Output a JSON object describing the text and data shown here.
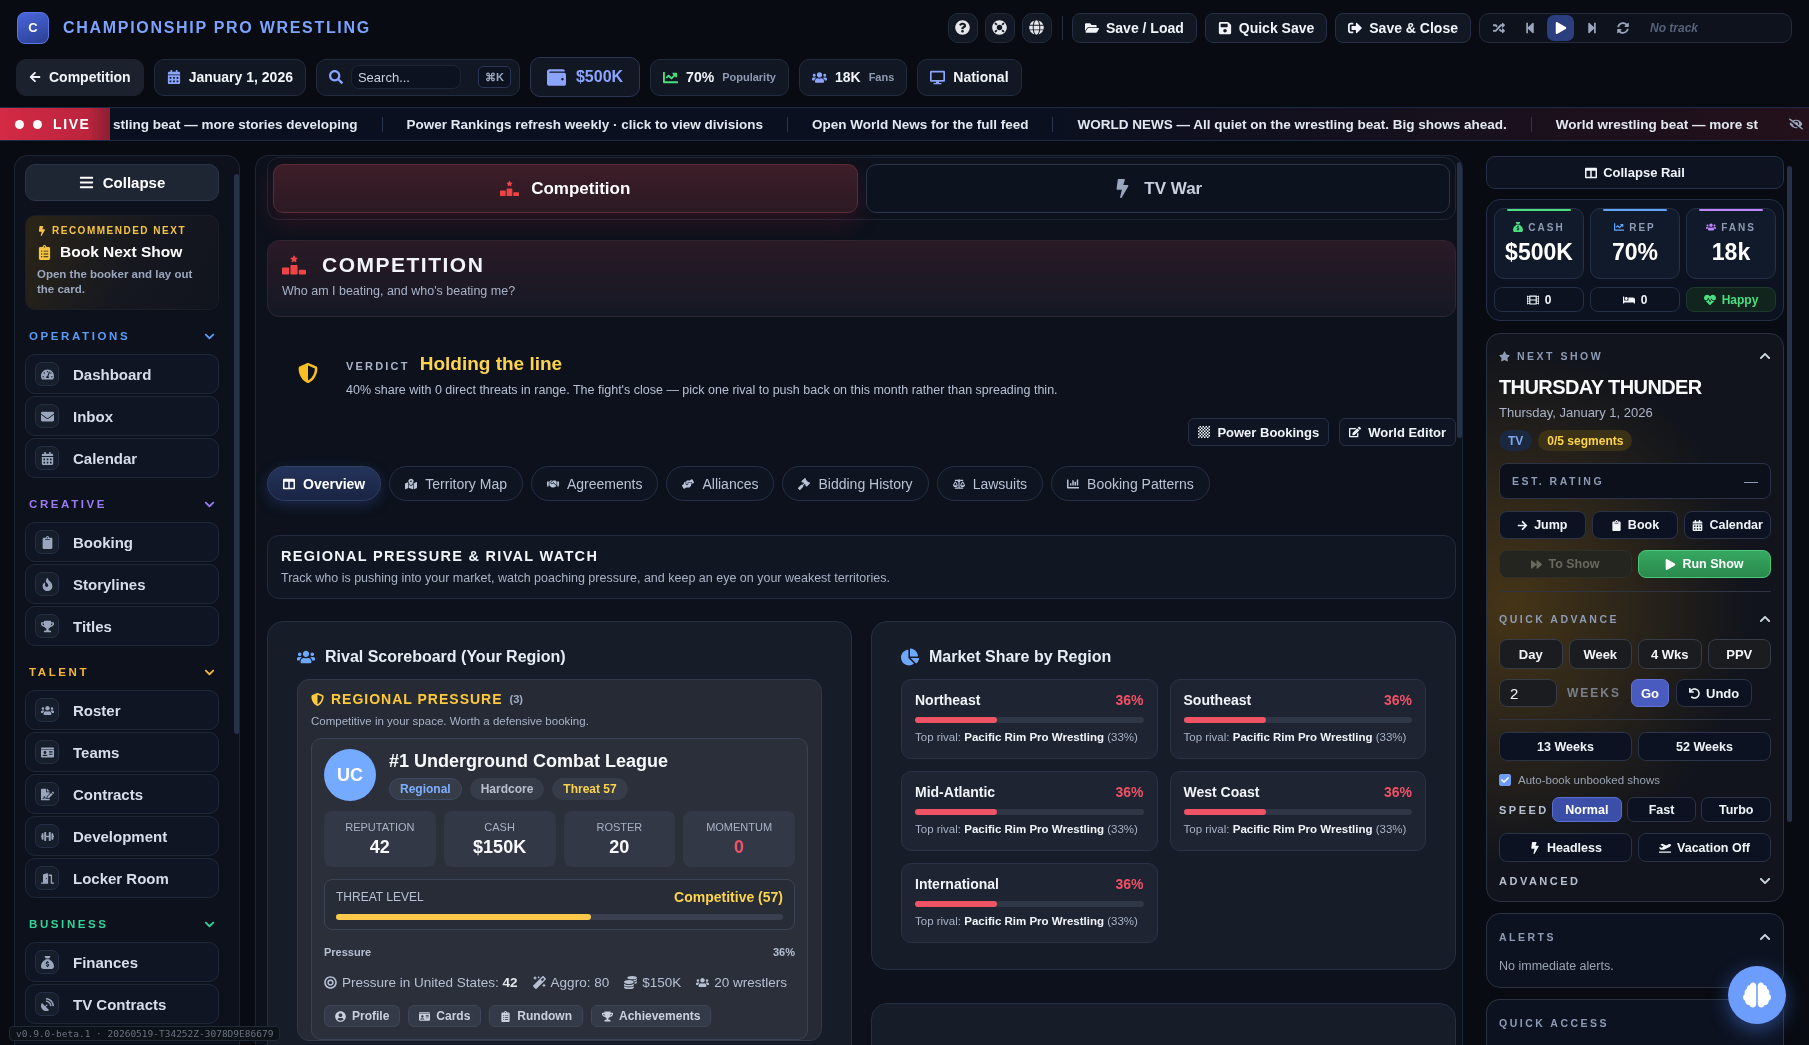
{
  "header": {
    "logo": "C",
    "title": "CHAMPIONSHIP PRO WRESTLING",
    "actions": [
      "Save / Load",
      "Quick Save",
      "Save & Close"
    ],
    "track": "No track"
  },
  "toolbar": {
    "back": "Competition",
    "date": "January 1, 2026",
    "search": {
      "placeholder": "Search...",
      "shortcut": "⌘K"
    },
    "stats": [
      {
        "kind": "money",
        "value": "$500K"
      },
      {
        "kind": "metric",
        "value": "70%",
        "label": "Popularity"
      },
      {
        "kind": "metric",
        "value": "18K",
        "label": "Fans"
      },
      {
        "kind": "plain",
        "value": "National"
      }
    ]
  },
  "ticker": {
    "badge": "LIVE",
    "items": [
      "stling beat — more stories developing",
      "Power Rankings refresh weekly · click to view divisions",
      "Open World News for the full feed",
      "WORLD NEWS — All quiet on the wrestling beat. Big shows ahead.",
      "World wrestling beat — more st"
    ]
  },
  "sidebar": {
    "collapse": "Collapse",
    "recommended": {
      "eyebrow": "RECOMMENDED NEXT",
      "title": "Book Next Show",
      "text": "Open the booker and lay out the card."
    },
    "sections": [
      {
        "title": "OPERATIONS",
        "color": "#5b9cf5",
        "expanded": true,
        "items": [
          "Dashboard",
          "Inbox",
          "Calendar"
        ]
      },
      {
        "title": "CREATIVE",
        "color": "#9b7cf6",
        "expanded": true,
        "items": [
          "Booking",
          "Storylines",
          "Titles"
        ]
      },
      {
        "title": "TALENT",
        "color": "#f5b833",
        "expanded": true,
        "items": [
          "Roster",
          "Teams",
          "Contracts",
          "Development",
          "Locker Room"
        ]
      },
      {
        "title": "BUSINESS",
        "color": "#34d399",
        "expanded": true,
        "items": [
          "Finances",
          "TV Contracts"
        ]
      }
    ]
  },
  "version": "v0.9.0-beta.1 · 20260519-T34252Z-3078D9E86679",
  "page_tabs": [
    {
      "label": "Competition",
      "selected": true
    },
    {
      "label": "TV War",
      "selected": false
    }
  ],
  "page_header": {
    "title": "COMPETITION",
    "subtitle": "Who am I beating, and who's beating me?"
  },
  "verdict": {
    "label": "VERDICT",
    "title": "Holding the line",
    "text": "40% share with 0 direct threats in range. The fight's close — pick one rival to push back on this month rather than spreading thin."
  },
  "tools": [
    "Power Bookings",
    "World Editor"
  ],
  "sub_tabs": [
    {
      "label": "Overview",
      "selected": true
    },
    {
      "label": "Territory Map",
      "selected": false
    },
    {
      "label": "Agreements",
      "selected": false
    },
    {
      "label": "Alliances",
      "selected": false
    },
    {
      "label": "Bidding History",
      "selected": false
    },
    {
      "label": "Lawsuits",
      "selected": false
    },
    {
      "label": "Booking Patterns",
      "selected": false
    }
  ],
  "overview": {
    "title": "REGIONAL PRESSURE & RIVAL WATCH",
    "text": "Track who is pushing into your market, watch poaching pressure, and keep an eye on your weakest territories."
  },
  "rival_scoreboard": {
    "title": "Rival Scoreboard (Your Region)",
    "pressure": {
      "title": "REGIONAL PRESSURE",
      "count": "(3)",
      "text": "Competitive in your space. Worth a defensive booking."
    },
    "rival": {
      "initials": "UC",
      "name": "#1 Underground Combat League",
      "tags": [
        {
          "kind": "region",
          "label": "Regional"
        },
        {
          "kind": "style",
          "label": "Hardcore"
        },
        {
          "kind": "threat",
          "label": "Threat 57"
        }
      ],
      "stats": [
        {
          "kind": "normal",
          "label": "REPUTATION",
          "value": "42"
        },
        {
          "kind": "normal",
          "label": "CASH",
          "value": "$150K"
        },
        {
          "kind": "normal",
          "label": "ROSTER",
          "value": "20"
        },
        {
          "kind": "negative",
          "label": "MOMENTUM",
          "value": "0"
        }
      ],
      "threat": {
        "label": "THREAT LEVEL",
        "reading": "Competitive (57)",
        "level": 0.57
      },
      "pressure_label": "Pressure",
      "pressure_reading": "36%",
      "facts": [
        "Pressure in United States: **42**",
        "Aggro: 80",
        "$150K",
        "20 wrestlers"
      ],
      "actions": [
        "Profile",
        "Cards",
        "Rundown",
        "Achievements"
      ]
    }
  },
  "market_share": {
    "title": "Market Share by Region",
    "regions": [
      {
        "name": "Northeast",
        "share": "36%",
        "level": 0.36,
        "rival": "Top rival: **Pacific Rim Pro Wrestling** (33%)"
      },
      {
        "name": "Southeast",
        "share": "36%",
        "level": 0.36,
        "rival": "Top rival: **Pacific Rim Pro Wrestling** (33%)"
      },
      {
        "name": "Mid-Atlantic",
        "share": "36%",
        "level": 0.36,
        "rival": "Top rival: **Pacific Rim Pro Wrestling** (33%)"
      },
      {
        "name": "West Coast",
        "share": "36%",
        "level": 0.36,
        "rival": "Top rival: **Pacific Rim Pro Wrestling** (33%)"
      },
      {
        "name": "International",
        "share": "36%",
        "level": 0.36,
        "rival": "Top rival: **Pacific Rim Pro Wrestling** (33%)"
      }
    ]
  },
  "rail": {
    "collapse": "Collapse Rail",
    "kpis": [
      {
        "label": "CASH",
        "value": "$500K",
        "color": "#4ade80"
      },
      {
        "label": "REP",
        "value": "70%",
        "color": "#60a5fa"
      },
      {
        "label": "FANS",
        "value": "18k",
        "color": "#c084fc"
      }
    ],
    "counters": [
      {
        "kind": "count",
        "value": "0"
      },
      {
        "kind": "count",
        "value": "0"
      },
      {
        "kind": "mood",
        "value": "Happy"
      }
    ],
    "next_show": {
      "label": "NEXT SHOW",
      "expanded": true,
      "title": "THURSDAY THUNDER",
      "date": "Thursday, January 1, 2026",
      "tags": [
        {
          "kind": "type",
          "label": "TV"
        },
        {
          "kind": "segments",
          "label": "0/5 segments"
        }
      ],
      "rating": {
        "label": "EST. RATING",
        "value": "—"
      },
      "actions": [
        "Jump",
        "Book",
        "Calendar"
      ],
      "to_show": {
        "label": "To Show",
        "disabled": true
      },
      "run": "Run Show"
    },
    "quick_advance": {
      "label": "QUICK ADVANCE",
      "expanded": true,
      "steps": [
        "Day",
        "Week",
        "4 Wks",
        "PPV"
      ],
      "weeks_value": "2",
      "weeks_label": "WEEKS",
      "go": "Go",
      "undo": "Undo",
      "long": [
        "13 Weeks",
        "52 Weeks"
      ],
      "auto_book": {
        "label": "Auto-book unbooked shows",
        "checked": true
      },
      "speed_label": "SPEED",
      "speeds": [
        {
          "label": "Normal",
          "selected": true
        },
        {
          "label": "Fast",
          "selected": false
        },
        {
          "label": "Turbo",
          "selected": false
        }
      ],
      "modes": [
        "Headless",
        "Vacation Off"
      ],
      "advanced": {
        "label": "ADVANCED",
        "expanded": false
      }
    },
    "alerts": {
      "label": "ALERTS",
      "expanded": true,
      "text": "No immediate alerts."
    },
    "quick_access": {
      "label": "QUICK ACCESS"
    }
  }
}
